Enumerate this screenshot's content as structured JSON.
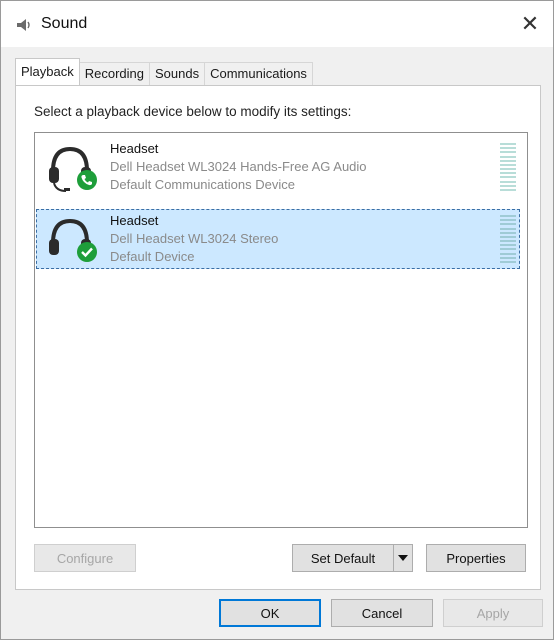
{
  "window": {
    "title": "Sound",
    "close_glyph": "✕"
  },
  "tabs": [
    {
      "label": "Playback",
      "active": true
    },
    {
      "label": "Recording",
      "active": false
    },
    {
      "label": "Sounds",
      "active": false
    },
    {
      "label": "Communications",
      "active": false
    }
  ],
  "playback": {
    "instruction": "Select a playback device below to modify its settings:",
    "devices": [
      {
        "name": "Headset",
        "description": "Dell Headset WL3024 Hands-Free AG Audio",
        "status": "Default Communications Device",
        "badge_icon": "phone-icon",
        "selected": false
      },
      {
        "name": "Headset",
        "description": "Dell Headset WL3024 Stereo",
        "status": "Default Device",
        "badge_icon": "check-icon",
        "selected": true
      }
    ]
  },
  "buttons": {
    "configure": "Configure",
    "set_default": "Set Default",
    "properties": "Properties",
    "ok": "OK",
    "cancel": "Cancel",
    "apply": "Apply"
  },
  "colors": {
    "selection": "#cce8ff",
    "badge_green": "#1e9e3a",
    "focus_blue": "#0078d7"
  }
}
